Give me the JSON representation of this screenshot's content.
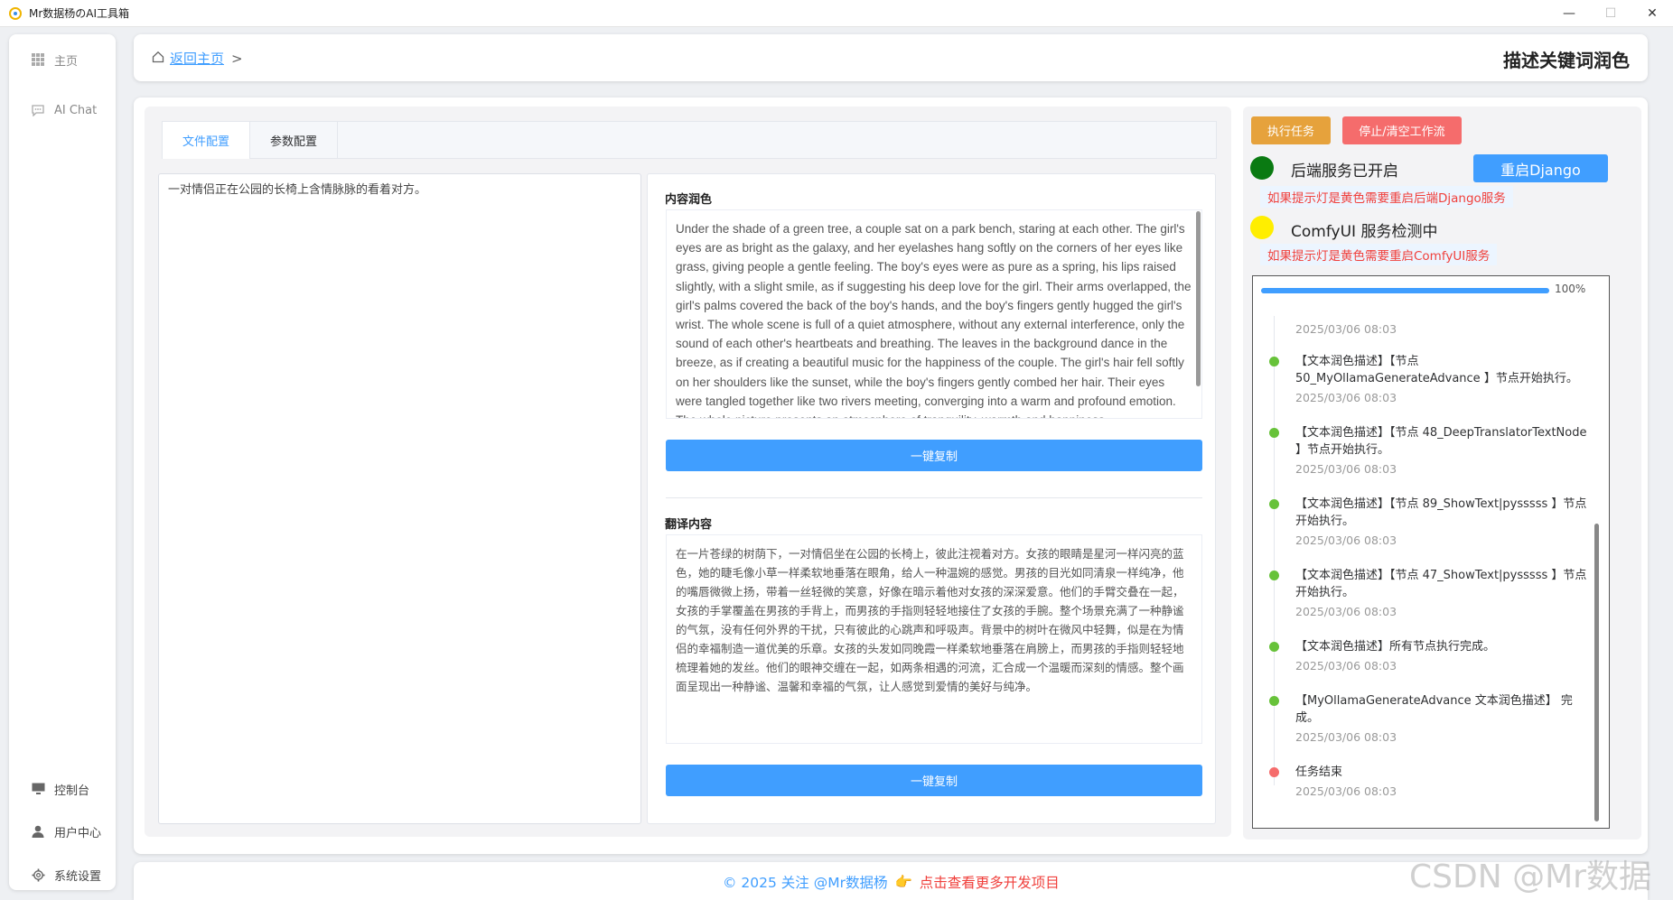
{
  "window": {
    "title": "Mr数据杨のAI工具箱"
  },
  "sidebar": {
    "top_items": [
      {
        "label": "主页",
        "icon": "grid-icon"
      },
      {
        "label": "AI Chat",
        "icon": "chat-icon"
      }
    ],
    "bottom_items": [
      {
        "label": "控制台",
        "icon": "monitor-icon"
      },
      {
        "label": "用户中心",
        "icon": "user-icon"
      },
      {
        "label": "系统设置",
        "icon": "gear-icon"
      }
    ]
  },
  "header": {
    "back_label": "返回主页",
    "separator": ">",
    "page_title": "描述关键词润色"
  },
  "tabs": [
    {
      "label": "文件配置",
      "active": true
    },
    {
      "label": "参数配置",
      "active": false
    }
  ],
  "input": {
    "value": "一对情侣正在公园的长椅上含情脉脉的看着对方。"
  },
  "polish": {
    "label": "内容润色",
    "text": "Under the shade of a green tree, a couple sat on a park bench, staring at each other. The girl's eyes are as bright as the galaxy, and her eyelashes hang softly on the corners of her eyes like grass, giving people a gentle feeling. The boy's eyes were as pure as a spring, his lips raised slightly, with a slight smile, as if suggesting his deep love for the girl. Their arms overlapped, the girl's palms covered the back of the boy's hands, and the boy's fingers gently hugged the girl's wrist. The whole scene is full of a quiet atmosphere, without any external interference, only the sound of each other's heartbeats and breathing. The leaves in the background dance in the breeze, as if creating a beautiful music for the happiness of the couple. The girl's hair fell softly on her shoulders like the sunset, while the boy's fingers gently combed her hair. Their eyes were tangled together like two rivers meeting, converging into a warm and profound emotion. The whole picture presents an atmosphere of tranquility, warmth and happiness.",
    "copy_label": "一键复制"
  },
  "translation": {
    "label": "翻译内容",
    "text": "在一片苍绿的树荫下，一对情侣坐在公园的长椅上，彼此注视着对方。女孩的眼睛是星河一样闪亮的蓝色，她的睫毛像小草一样柔软地垂落在眼角，给人一种温婉的感觉。男孩的目光如同清泉一样纯净，他的嘴唇微微上扬，带着一丝轻微的笑意，好像在暗示着他对女孩的深深爱意。他们的手臂交叠在一起，女孩的手掌覆盖在男孩的手背上，而男孩的手指则轻轻地接住了女孩的手腕。整个场景充满了一种静谧的气氛，没有任何外界的干扰，只有彼此的心跳声和呼吸声。背景中的树叶在微风中轻舞，似是在为情侣的幸福制造一道优美的乐章。女孩的头发如同晚霞一样柔软地垂落在肩膀上，而男孩的手指则轻轻地梳理着她的发丝。他们的眼神交缠在一起，如两条相遇的河流，汇合成一个温暖而深刻的情感。整个画面呈现出一种静谧、温馨和幸福的气氛，让人感觉到爱情的美好与纯净。",
    "copy_label": "一键复制"
  },
  "controls": {
    "run_label": "执行任务",
    "stop_label": "停止/清空工作流",
    "restart_label": "重启Django"
  },
  "status": {
    "backend_text": "后端服务已开启",
    "backend_color": "#0a7a12",
    "backend_hint": "如果提示灯是黄色需要重启后端Django服务",
    "comfy_text": "ComfyUI 服务检测中",
    "comfy_color": "#ffee00",
    "comfy_hint": "如果提示灯是黄色需要重启ComfyUI服务"
  },
  "progress": {
    "value": 1.0,
    "label": "100%"
  },
  "log": {
    "first_time": "2025/03/06 08:03",
    "entries": [
      {
        "msg": "【文本润色描述】【节点 50_MyOllamaGenerateAdvance 】节点开始执行。",
        "time": "2025/03/06 08:03",
        "status": "ok"
      },
      {
        "msg": "【文本润色描述】【节点 48_DeepTranslatorTextNode 】节点开始执行。",
        "time": "2025/03/06 08:03",
        "status": "ok"
      },
      {
        "msg": "【文本润色描述】【节点 89_ShowText|pysssss 】节点开始执行。",
        "time": "2025/03/06 08:03",
        "status": "ok"
      },
      {
        "msg": "【文本润色描述】【节点 47_ShowText|pysssss 】节点开始执行。",
        "time": "2025/03/06 08:03",
        "status": "ok"
      },
      {
        "msg": "【文本润色描述】所有节点执行完成。",
        "time": "2025/03/06 08:03",
        "status": "ok"
      },
      {
        "msg": "【MyOllamaGenerateAdvance 文本润色描述】 完成。",
        "time": "2025/03/06 08:03",
        "status": "ok"
      },
      {
        "msg": "任务结束",
        "time": "2025/03/06 08:03",
        "status": "end"
      }
    ]
  },
  "footer": {
    "copyright": "© 2025 关注 @Mr数据杨",
    "hand_icon": "pointing-hand-icon",
    "link": "点击查看更多开发项目"
  },
  "watermark": "CSDN @Mr数据杨"
}
